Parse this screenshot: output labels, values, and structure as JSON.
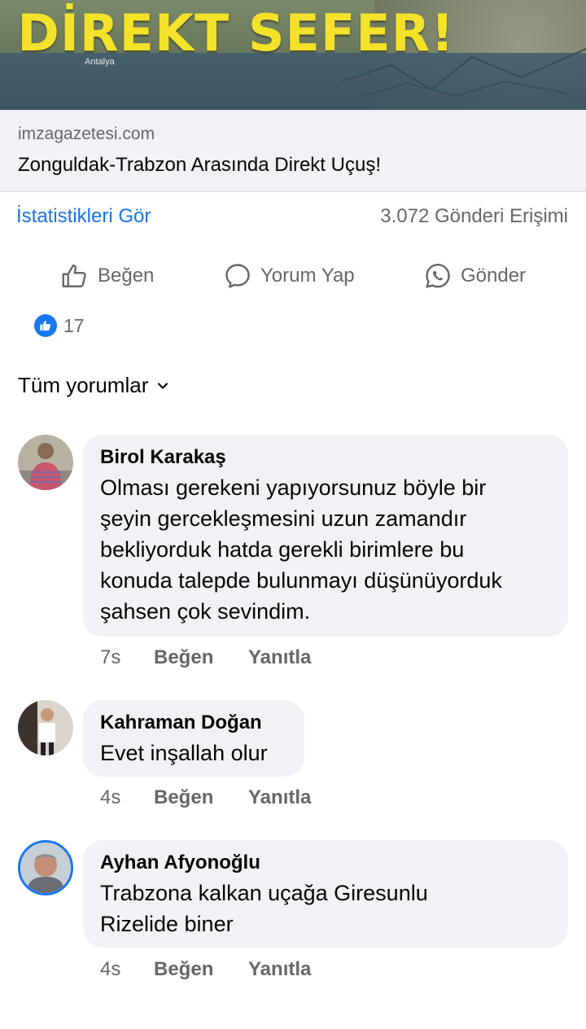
{
  "post": {
    "headline": "DİREKT SEFER!",
    "map_place": "Antalya",
    "link_domain": "imzagazetesi.com",
    "link_title": "Zonguldak-Trabzon Arasında Direkt Uçuş!"
  },
  "stats": {
    "view_insights": "İstatistikleri Gör",
    "reach": "3.072 Gönderi Erişimi"
  },
  "actions": {
    "like": "Beğen",
    "comment": "Yorum Yap",
    "send": "Gönder"
  },
  "reactions": {
    "count": "17"
  },
  "comments_filter": "Tüm yorumlar",
  "comments": [
    {
      "author": "Birol Karakaş",
      "lines": [
        "Olması gerekeni yapıyorsunuz böyle bir",
        "şeyin gercekleşmesini uzun zamandır",
        "bekliyorduk hatda gerekli birimlere bu",
        "konuda talepde bulunmayı düşünüyorduk",
        "şahsen çok sevindim."
      ],
      "time": "7s",
      "like": "Beğen",
      "reply": "Yanıtla"
    },
    {
      "author": "Kahraman Doğan",
      "lines": [
        "Evet inşallah olur"
      ],
      "time": "4s",
      "like": "Beğen",
      "reply": "Yanıtla"
    },
    {
      "author": "Ayhan Afyonoğlu",
      "lines": [
        "Trabzona kalkan uçağa Giresunlu",
        "Rizelide biner"
      ],
      "time": "4s",
      "like": "Beğen",
      "reply": "Yanıtla"
    }
  ],
  "colors": {
    "link_blue": "#1b74e4",
    "like_blue": "#1877f2",
    "bubble_gray": "#f0f2f5",
    "headline_yellow": "#f3e12a"
  },
  "icons": [
    "thumbs-up-icon",
    "comment-bubble-icon",
    "whatsapp-icon",
    "chevron-down-icon"
  ]
}
